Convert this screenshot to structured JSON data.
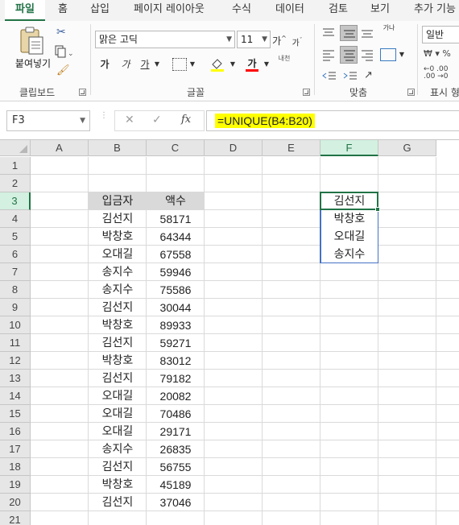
{
  "ribbon_tabs": [
    "파일",
    "홈",
    "삽입",
    "페이지 레이아웃",
    "수식",
    "데이터",
    "검토",
    "보기",
    "추가 기능"
  ],
  "ribbon": {
    "clipboard": {
      "paste_label": "붙여넣기",
      "group_label": "클립보드"
    },
    "font": {
      "font_name": "맑은 고딕",
      "font_size": "11",
      "bold": "가",
      "italic": "가",
      "underline": "가",
      "grow": "가",
      "shrink": "가",
      "font_color_glyph": "가",
      "phonetic": "내천",
      "group_label": "글꼴"
    },
    "alignment": {
      "wrap": "가나",
      "group_label": "맞춤"
    },
    "number": {
      "format": "일반",
      "group_label": "표시 형"
    }
  },
  "formula_bar": {
    "name_box": "F3",
    "fx": "fx",
    "formula": "=UNIQUE(B4:B20)"
  },
  "columns": [
    "A",
    "B",
    "C",
    "D",
    "E",
    "F",
    "G"
  ],
  "rows": [
    "1",
    "2",
    "3",
    "4",
    "5",
    "6",
    "7",
    "8",
    "9",
    "10",
    "11",
    "12",
    "13",
    "14",
    "15",
    "16",
    "17",
    "18",
    "19",
    "20",
    "21"
  ],
  "table": {
    "headers": [
      "입금자",
      "액수"
    ],
    "data": [
      [
        "김선지",
        "58171"
      ],
      [
        "박창호",
        "64344"
      ],
      [
        "오대길",
        "67558"
      ],
      [
        "송지수",
        "59946"
      ],
      [
        "송지수",
        "75586"
      ],
      [
        "김선지",
        "30044"
      ],
      [
        "박창호",
        "89933"
      ],
      [
        "김선지",
        "59271"
      ],
      [
        "박창호",
        "83012"
      ],
      [
        "김선지",
        "79182"
      ],
      [
        "오대길",
        "20082"
      ],
      [
        "오대길",
        "70486"
      ],
      [
        "오대길",
        "29171"
      ],
      [
        "송지수",
        "26835"
      ],
      [
        "김선지",
        "56755"
      ],
      [
        "박창호",
        "45189"
      ],
      [
        "김선지",
        "37046"
      ]
    ]
  },
  "unique_result": [
    "김선지",
    "박창호",
    "오대길",
    "송지수"
  ],
  "colors": {
    "accent": "#217346",
    "spill_border": "#4472c4",
    "formula_highlight": "#ffff00",
    "header_fill": "#d9d9d9"
  }
}
